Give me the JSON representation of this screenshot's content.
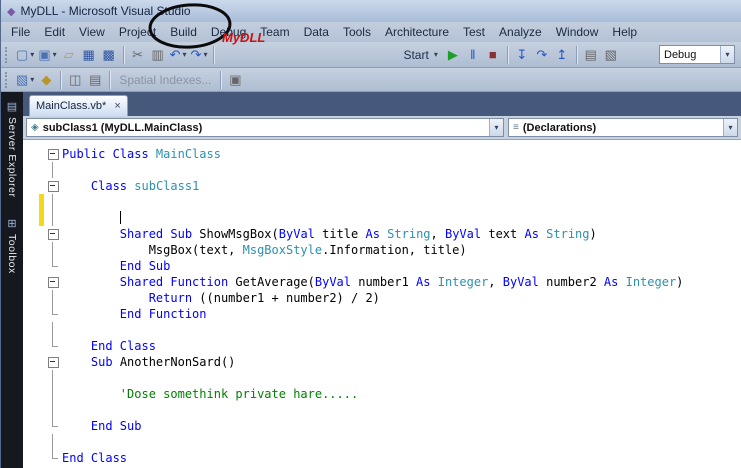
{
  "window": {
    "title": "MyDLL - Microsoft Visual Studio",
    "logo_glyph": "◆"
  },
  "menu": {
    "items": [
      "File",
      "Edit",
      "View",
      "Project",
      "Build",
      "Debug",
      "Team",
      "Data",
      "Tools",
      "Architecture",
      "Test",
      "Analyze",
      "Window",
      "Help"
    ]
  },
  "annotation": {
    "label": "MyDLL",
    "color": "#cc1111",
    "circled_menu": "Build"
  },
  "toolbar1": [
    {
      "n": "new-project-button",
      "g": "▢",
      "c": "#4a72b2",
      "dd": true
    },
    {
      "n": "add-new-item-button",
      "g": "▣",
      "c": "#4a72b2",
      "dd": true
    },
    {
      "n": "open-file-button",
      "g": "▱",
      "c": "#c9973c"
    },
    {
      "n": "save-button",
      "g": "▦",
      "c": "#2f55a0"
    },
    {
      "n": "save-all-button",
      "g": "▩",
      "c": "#2f55a0"
    },
    {
      "sep": true
    },
    {
      "n": "cut-button",
      "g": "✂",
      "c": "#666666"
    },
    {
      "n": "copy-button",
      "g": "▥",
      "c": "#666666"
    },
    {
      "n": "undo-button",
      "g": "↶",
      "c": "#2456c4",
      "dd": true
    },
    {
      "n": "redo-button",
      "g": "↷",
      "c": "#2456c4",
      "dd": true
    },
    {
      "sep": true
    },
    {
      "gap": 180
    },
    {
      "n": "start-dropdown",
      "label": "Start",
      "dd": true
    },
    {
      "n": "start-debugging-button",
      "g": "▶",
      "c": "#1d9e27"
    },
    {
      "n": "break-all-button",
      "g": "‖",
      "c": "#2456c4"
    },
    {
      "n": "stop-debugging-button",
      "g": "■",
      "c": "#8b3030"
    },
    {
      "sep": true
    },
    {
      "n": "step-into-button",
      "g": "↧",
      "c": "#2456c4"
    },
    {
      "n": "step-over-button",
      "g": "↷",
      "c": "#2456c4"
    },
    {
      "n": "step-out-button",
      "g": "↥",
      "c": "#2456c4"
    },
    {
      "sep": true
    },
    {
      "n": "immediate-window-button",
      "g": "▤",
      "c": "#666666"
    },
    {
      "n": "output-window-button",
      "g": "▧",
      "c": "#666666"
    },
    {
      "n": "solution-configurations-combo",
      "combo": "Debug"
    }
  ],
  "toolbar2": [
    {
      "n": "generate-change-script-button",
      "g": "▧",
      "c": "#4a72b2",
      "dd": true
    },
    {
      "n": "primary-key-button",
      "g": "◆",
      "c": "#b9952f"
    },
    {
      "sep": true
    },
    {
      "n": "relationships-button",
      "g": "◫",
      "c": "#666666"
    },
    {
      "n": "manage-indexes-button",
      "g": "▤",
      "c": "#666666"
    },
    {
      "sep": true
    },
    {
      "n": "spatial-indexes-button",
      "label": "Spatial Indexes...",
      "disabled": true
    },
    {
      "sep": true
    },
    {
      "n": "fulltext-index-button",
      "g": "▣",
      "c": "#666666"
    }
  ],
  "tab": {
    "label": "MainClass.vb*",
    "close_glyph": "×"
  },
  "navbar": {
    "scope": "subClass1 (MyDLL.MainClass)",
    "scope_icon": "◈",
    "member": "(Declarations)",
    "member_icon": "≡",
    "arrow_glyph": "▾"
  },
  "side_tabs": [
    {
      "label": "Server Explorer",
      "icon": "▤",
      "icon_name": "server-explorer-icon"
    },
    {
      "label": "Toolbox",
      "icon": "⊞",
      "icon_name": "toolbox-icon"
    }
  ],
  "editor": {
    "colors": {
      "keyword": "#0000ff",
      "type": "#2b91af",
      "comment": "#008000",
      "plain": "#000000",
      "change_bar": "#f5d817"
    },
    "lines": [
      {
        "fold": "start",
        "segs": [
          {
            "c": "kw",
            "t": "Public Class "
          },
          {
            "c": "type",
            "t": "MainClass"
          }
        ]
      },
      {
        "fold": "mid",
        "segs": []
      },
      {
        "fold": "start",
        "segs": [
          {
            "c": "plain",
            "t": "    "
          },
          {
            "c": "kw",
            "t": "Class "
          },
          {
            "c": "type",
            "t": "subClass1"
          }
        ]
      },
      {
        "fold": "mid",
        "segs": [],
        "changed": true
      },
      {
        "fold": "mid",
        "segs": [
          {
            "c": "plain",
            "t": "        "
          }
        ],
        "cursor": true,
        "changed": true
      },
      {
        "fold": "start",
        "segs": [
          {
            "c": "plain",
            "t": "        "
          },
          {
            "c": "kw",
            "t": "Shared Sub "
          },
          {
            "c": "plain",
            "t": "ShowMsgBox("
          },
          {
            "c": "kw",
            "t": "ByVal "
          },
          {
            "c": "plain",
            "t": "title "
          },
          {
            "c": "kw",
            "t": "As "
          },
          {
            "c": "type",
            "t": "String"
          },
          {
            "c": "plain",
            "t": ", "
          },
          {
            "c": "kw",
            "t": "ByVal "
          },
          {
            "c": "plain",
            "t": "text "
          },
          {
            "c": "kw",
            "t": "As "
          },
          {
            "c": "type",
            "t": "String"
          },
          {
            "c": "plain",
            "t": ")"
          }
        ]
      },
      {
        "fold": "mid",
        "segs": [
          {
            "c": "plain",
            "t": "            MsgBox(text, "
          },
          {
            "c": "type",
            "t": "MsgBoxStyle"
          },
          {
            "c": "plain",
            "t": ".Information, title)"
          }
        ]
      },
      {
        "fold": "end",
        "segs": [
          {
            "c": "plain",
            "t": "        "
          },
          {
            "c": "kw",
            "t": "End Sub"
          }
        ]
      },
      {
        "fold": "start",
        "segs": [
          {
            "c": "plain",
            "t": "        "
          },
          {
            "c": "kw",
            "t": "Shared Function "
          },
          {
            "c": "plain",
            "t": "GetAverage("
          },
          {
            "c": "kw",
            "t": "ByVal "
          },
          {
            "c": "plain",
            "t": "number1 "
          },
          {
            "c": "kw",
            "t": "As "
          },
          {
            "c": "type",
            "t": "Integer"
          },
          {
            "c": "plain",
            "t": ", "
          },
          {
            "c": "kw",
            "t": "ByVal "
          },
          {
            "c": "plain",
            "t": "number2 "
          },
          {
            "c": "kw",
            "t": "As "
          },
          {
            "c": "type",
            "t": "Integer"
          },
          {
            "c": "plain",
            "t": ")"
          }
        ]
      },
      {
        "fold": "mid",
        "segs": [
          {
            "c": "plain",
            "t": "            "
          },
          {
            "c": "kw",
            "t": "Return "
          },
          {
            "c": "plain",
            "t": "((number1 + number2) / 2)"
          }
        ]
      },
      {
        "fold": "end",
        "segs": [
          {
            "c": "plain",
            "t": "        "
          },
          {
            "c": "kw",
            "t": "End Function"
          }
        ]
      },
      {
        "fold": "mid",
        "segs": []
      },
      {
        "fold": "end",
        "segs": [
          {
            "c": "plain",
            "t": "    "
          },
          {
            "c": "kw",
            "t": "End Class"
          }
        ]
      },
      {
        "fold": "start",
        "segs": [
          {
            "c": "plain",
            "t": "    "
          },
          {
            "c": "kw",
            "t": "Sub "
          },
          {
            "c": "plain",
            "t": "AnotherNonSard()"
          }
        ]
      },
      {
        "fold": "mid",
        "segs": []
      },
      {
        "fold": "mid",
        "segs": [
          {
            "c": "comment",
            "t": "        'Dose somethink private hare....."
          }
        ]
      },
      {
        "fold": "mid",
        "segs": []
      },
      {
        "fold": "end",
        "segs": [
          {
            "c": "plain",
            "t": "    "
          },
          {
            "c": "kw",
            "t": "End Sub"
          }
        ]
      },
      {
        "fold": "mid",
        "segs": []
      },
      {
        "fold": "end",
        "segs": [
          {
            "c": "kw",
            "t": "End Class"
          }
        ]
      }
    ]
  }
}
